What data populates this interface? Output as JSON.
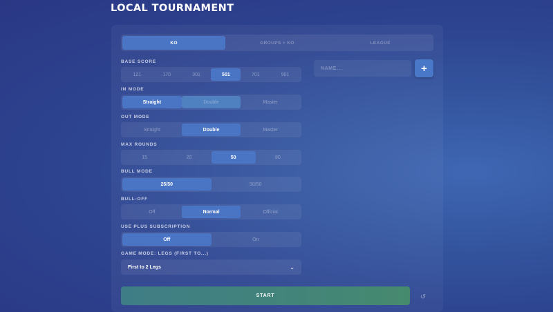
{
  "page": {
    "title": "LOCAL TOURNAMENT"
  },
  "tabs": [
    {
      "label": "KO",
      "active": true
    },
    {
      "label": "GROUPS + KO",
      "active": false
    },
    {
      "label": "LEAGUE",
      "active": false
    }
  ],
  "settings": {
    "base_score": {
      "label": "BASE SCORE",
      "options": [
        "121",
        "170",
        "301",
        "501",
        "701",
        "901"
      ],
      "selected": "501"
    },
    "in_mode": {
      "label": "IN MODE",
      "options": [
        "Straight",
        "Double",
        "Master"
      ],
      "selected": "Straight"
    },
    "out_mode": {
      "label": "OUT MODE",
      "options": [
        "Straight",
        "Double",
        "Master"
      ],
      "selected": "Double"
    },
    "max_rounds": {
      "label": "MAX ROUNDS",
      "options": [
        "15",
        "20",
        "50",
        "80"
      ],
      "selected": "50"
    },
    "bull_mode": {
      "label": "BULL MODE",
      "options": [
        "25/50",
        "50/50"
      ],
      "selected": "25/50"
    },
    "bull_off": {
      "label": "BULL-OFF",
      "options": [
        "Off",
        "Normal",
        "Official"
      ],
      "selected": "Normal"
    },
    "plus_subscription": {
      "label": "USE PLUS SUBSCRIPTION",
      "options": [
        "Off",
        "On"
      ],
      "selected": "Off"
    },
    "game_mode": {
      "label": "GAME MODE: LEGS (FIRST TO...)",
      "value": "First to 2 Legs"
    }
  },
  "player_input": {
    "placeholder": "NAME..."
  },
  "buttons": {
    "add": "+",
    "start": "START",
    "reset": "↺"
  },
  "colors": {
    "accent": "#4a74c4",
    "start": "#43847a"
  }
}
